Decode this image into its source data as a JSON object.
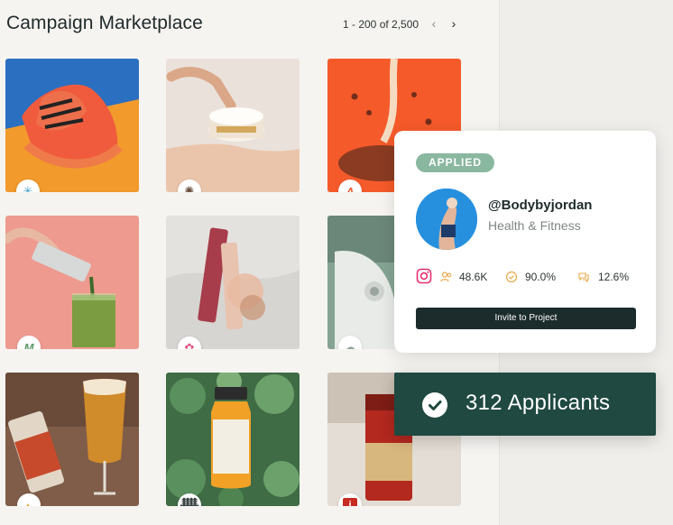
{
  "page": {
    "title": "Campaign Marketplace"
  },
  "pager": {
    "range": "1 - 200 of 2,500",
    "prev": "‹",
    "next": "›"
  },
  "tiles": [
    {
      "name": "sneakers",
      "brand": "✳",
      "brand_color": "#48a3c6"
    },
    {
      "name": "skincare-jar",
      "brand": "✺",
      "brand_color": "#6b5141"
    },
    {
      "name": "cereal-splash",
      "brand": "A",
      "brand_color": "#e8623a"
    },
    {
      "name": "green-juice",
      "brand": "M",
      "brand_color": "#5e9b6c"
    },
    {
      "name": "lipstick-flowers",
      "brand": "✿",
      "brand_color": "#e04d7e"
    },
    {
      "name": "espresso-machine",
      "brand": "☁",
      "brand_color": "#8aa19a"
    },
    {
      "name": "ipa-beer",
      "brand": "◐",
      "brand_color": "#e0b040"
    },
    {
      "name": "juice-bottle",
      "brand": "ᚙ",
      "brand_color": "#3c4444"
    },
    {
      "name": "coffee-can",
      "brand": "i",
      "brand_color": "#c72b21"
    }
  ],
  "creator": {
    "status": "APPLIED",
    "handle": "@Bodybyjordan",
    "niche": "Health & Fitness",
    "followers": "48.6K",
    "rate": "90.0%",
    "engagement": "12.6%",
    "invite_label": "Invite to Project"
  },
  "applicants": {
    "label": "312 Applicants"
  },
  "colors": {
    "accent": "#1f4941",
    "badge": "#8ab79f",
    "button": "#1c2c2c"
  }
}
